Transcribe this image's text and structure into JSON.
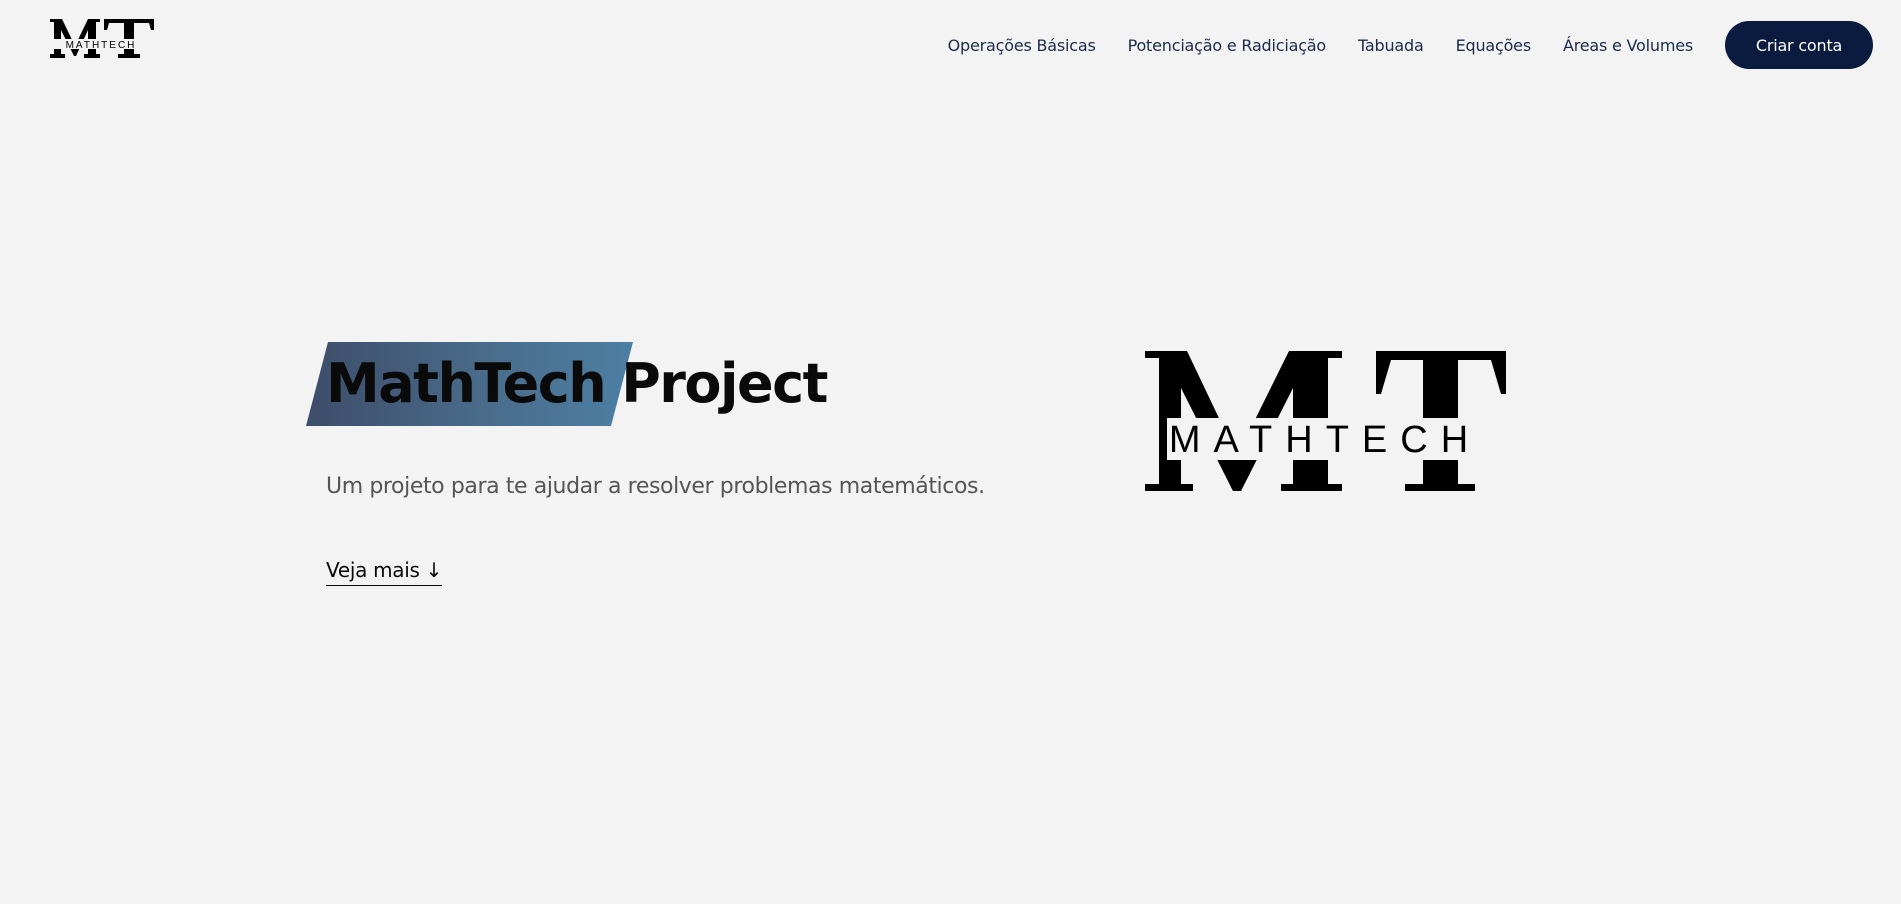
{
  "header": {
    "logo": {
      "letters": "MT",
      "wordmark": "MATHTECH"
    },
    "nav": [
      {
        "label": "Operações Básicas"
      },
      {
        "label": "Potenciação e Radiciação"
      },
      {
        "label": "Tabuada"
      },
      {
        "label": "Equações"
      },
      {
        "label": "Áreas e Volumes"
      }
    ],
    "cta_label": "Criar conta"
  },
  "hero": {
    "title_highlight": "MathTech",
    "title_rest": "Project",
    "subtitle": "Um projeto para te ajudar a resolver problemas matemáticos.",
    "link_label": "Veja mais ↓",
    "logo": {
      "letters": "MT",
      "wordmark": "MATHTECH"
    }
  },
  "colors": {
    "background": "#f3f3f3",
    "nav_text": "#1c2b4a",
    "cta_background": "#0a1b3f",
    "cta_text": "#ffffff",
    "highlight_start": "#3d4d69",
    "highlight_end": "#4c7fa3",
    "title_text": "#0a0a0a",
    "subtitle_text": "#555555"
  }
}
